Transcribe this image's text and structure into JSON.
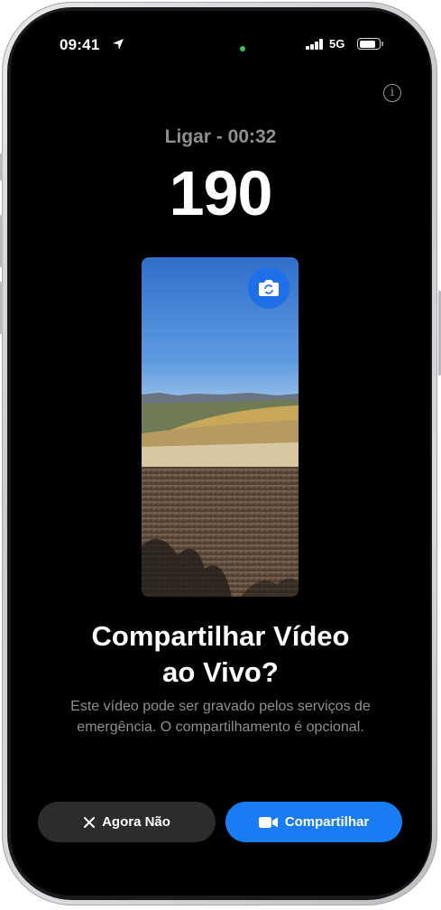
{
  "status_bar": {
    "time": "09:41",
    "network": "5G",
    "signal_bars": 4,
    "battery_level": 0.85,
    "camera_indicator_color": "#35c759"
  },
  "info_button": {
    "label": "i"
  },
  "call": {
    "label": "Ligar - 00:32",
    "number": "190"
  },
  "preview": {
    "flip_icon": "camera-flip-icon",
    "accent": "#1f6fe8"
  },
  "prompt": {
    "title_line1": "Compartilhar Vídeo",
    "title_line2": "ao Vivo?",
    "description_line1": "Este vídeo pode ser gravado pelos serviços de",
    "description_line2": "emergência. O compartilhamento é opcional."
  },
  "actions": {
    "decline_label": "Agora Não",
    "decline_icon": "close-icon",
    "share_label": "Compartilhar",
    "share_icon": "video-camera-icon",
    "share_color": "#1a7cf5"
  }
}
